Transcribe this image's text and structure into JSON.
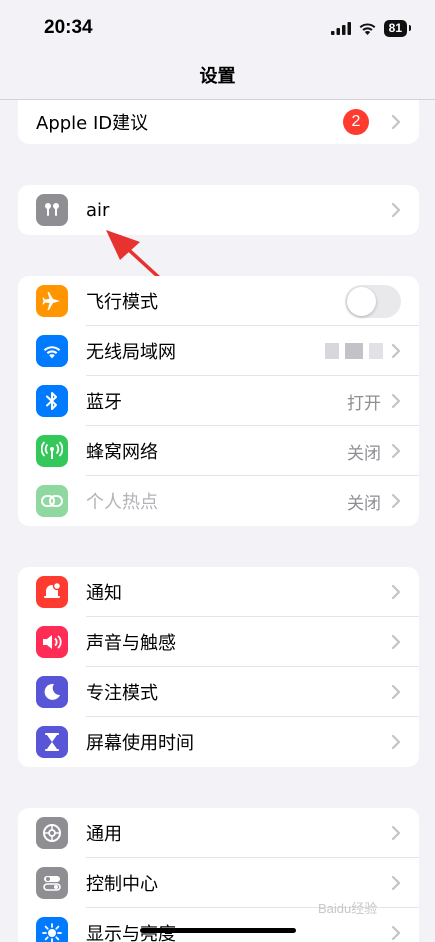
{
  "status": {
    "time": "20:34",
    "battery": "81"
  },
  "nav": {
    "title": "设置"
  },
  "apple_id": {
    "label": "Apple ID建议",
    "badge": "2"
  },
  "device": {
    "label": "air"
  },
  "connectivity": [
    {
      "label": "飞行模式",
      "icon": "airplane-icon",
      "color": "#ff9500",
      "toggle": "off"
    },
    {
      "label": "无线局域网",
      "icon": "wifi-icon",
      "color": "#007aff",
      "value": ""
    },
    {
      "label": "蓝牙",
      "icon": "bluetooth-icon",
      "color": "#007aff",
      "value": "打开"
    },
    {
      "label": "蜂窝网络",
      "icon": "cellular-icon",
      "color": "#34c759",
      "value": "关闭"
    },
    {
      "label": "个人热点",
      "icon": "hotspot-icon",
      "color": "#8fd9a0",
      "value": "关闭"
    }
  ],
  "notifications": [
    {
      "label": "通知",
      "icon": "bell-icon",
      "color": "#ff3b30"
    },
    {
      "label": "声音与触感",
      "icon": "speaker-icon",
      "color": "#ff2d55"
    },
    {
      "label": "专注模式",
      "icon": "moon-icon",
      "color": "#5856d6"
    },
    {
      "label": "屏幕使用时间",
      "icon": "hourglass-icon",
      "color": "#5856d6"
    }
  ],
  "general": [
    {
      "label": "通用",
      "icon": "gear-icon",
      "color": "#8e8e93"
    },
    {
      "label": "控制中心",
      "icon": "switches-icon",
      "color": "#8e8e93"
    },
    {
      "label": "显示与亮度",
      "icon": "sun-icon",
      "color": "#007aff"
    }
  ],
  "watermark": "Baidu经验"
}
